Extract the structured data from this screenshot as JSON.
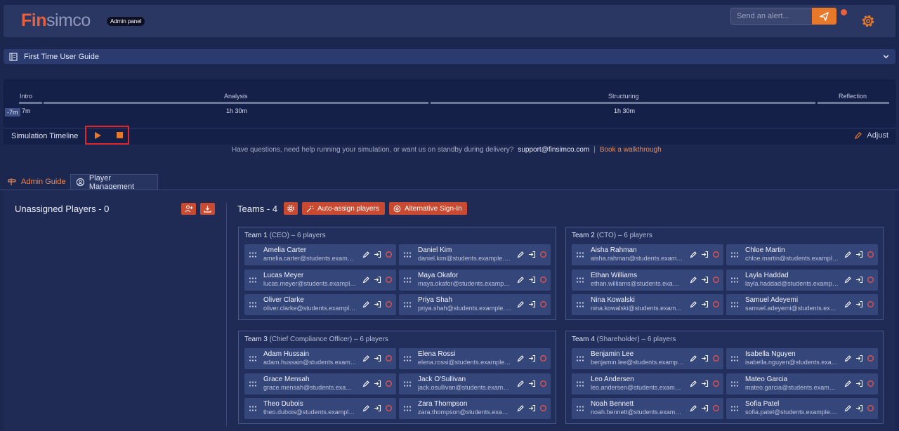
{
  "header": {
    "logo_prefix": "Fin",
    "logo_suffix": "simco",
    "badge": "Admin panel",
    "alert_placeholder": "Send an alert...",
    "accent": "#e9792a"
  },
  "guide": {
    "title": "First Time User Guide"
  },
  "timeline": {
    "label": "Simulation Timeline",
    "offset_badge": "-7m",
    "adjust_label": "Adjust",
    "phases": [
      {
        "name": "Intro",
        "duration": "7m"
      },
      {
        "name": "Analysis",
        "duration": "1h 30m"
      },
      {
        "name": "Structuring",
        "duration": "1h 30m"
      },
      {
        "name": "Reflection",
        "duration": ""
      }
    ]
  },
  "help": {
    "text": "Have questions, need help running your simulation, or want us on standby during delivery?",
    "email": "support@finsimco.com",
    "separator": "|",
    "walkthrough": "Book a walkthrough"
  },
  "tabs": {
    "admin_guide": "Admin Guide",
    "player_management": "Player Management"
  },
  "unassigned": {
    "title": "Unassigned Players - 0"
  },
  "teams_section": {
    "title": "Teams - 4",
    "auto_assign": "Auto-assign players",
    "alt_signin": "Alternative Sign-In"
  },
  "teams": [
    {
      "name": "Team 1",
      "sub": "(CEO) – 6 players",
      "players": [
        {
          "name": "Amelia Carter",
          "email": "amelia.carter@students.example.com"
        },
        {
          "name": "Daniel Kim",
          "email": "daniel.kim@students.example.com"
        },
        {
          "name": "Lucas Meyer",
          "email": "lucas.meyer@students.example.com"
        },
        {
          "name": "Maya Okafor",
          "email": "maya.okafor@students.example.com"
        },
        {
          "name": "Oliver Clarke",
          "email": "oliver.clarke@students.example.com"
        },
        {
          "name": "Priya Shah",
          "email": "priya.shah@students.example.com"
        }
      ]
    },
    {
      "name": "Team 2",
      "sub": "(CTO) – 6 players",
      "players": [
        {
          "name": "Aisha Rahman",
          "email": "aisha.rahman@students.example.com"
        },
        {
          "name": "Chloe Martin",
          "email": "chloe.martin@students.example.com"
        },
        {
          "name": "Ethan Williams",
          "email": "ethan.williams@students.example.com"
        },
        {
          "name": "Layla Haddad",
          "email": "layla.haddad@students.example.com"
        },
        {
          "name": "Nina Kowalski",
          "email": "nina.kowalski@students.example.com"
        },
        {
          "name": "Samuel Adeyemi",
          "email": "samuel.adeyemi@students.example.com"
        }
      ]
    },
    {
      "name": "Team 3",
      "sub": "(Chief Compliance Officer) – 6 players",
      "players": [
        {
          "name": "Adam Hussain",
          "email": "adam.hussain@students.example.com"
        },
        {
          "name": "Elena Rossi",
          "email": "elena.rossi@students.example.com"
        },
        {
          "name": "Grace Mensah",
          "email": "grace.mensah@students.example.com"
        },
        {
          "name": "Jack O'Sullivan",
          "email": "jack.osullivan@students.example.com"
        },
        {
          "name": "Theo Dubois",
          "email": "theo.dubois@students.example.com"
        },
        {
          "name": "Zara Thompson",
          "email": "zara.thompson@students.example.com"
        }
      ]
    },
    {
      "name": "Team 4",
      "sub": "(Shareholder) – 6 players",
      "players": [
        {
          "name": "Benjamin Lee",
          "email": "benjamin.lee@students.example.com"
        },
        {
          "name": "Isabella Nguyen",
          "email": "isabella.nguyen@students.example.com"
        },
        {
          "name": "Leo Andersen",
          "email": "leo.andersen@students.example.com"
        },
        {
          "name": "Mateo Garcia",
          "email": "mateo.garcia@students.example.com"
        },
        {
          "name": "Noah Bennett",
          "email": "noah.bennett@students.example.com"
        },
        {
          "name": "Sofia Patel",
          "email": "sofia.patel@students.example.com"
        }
      ]
    }
  ]
}
